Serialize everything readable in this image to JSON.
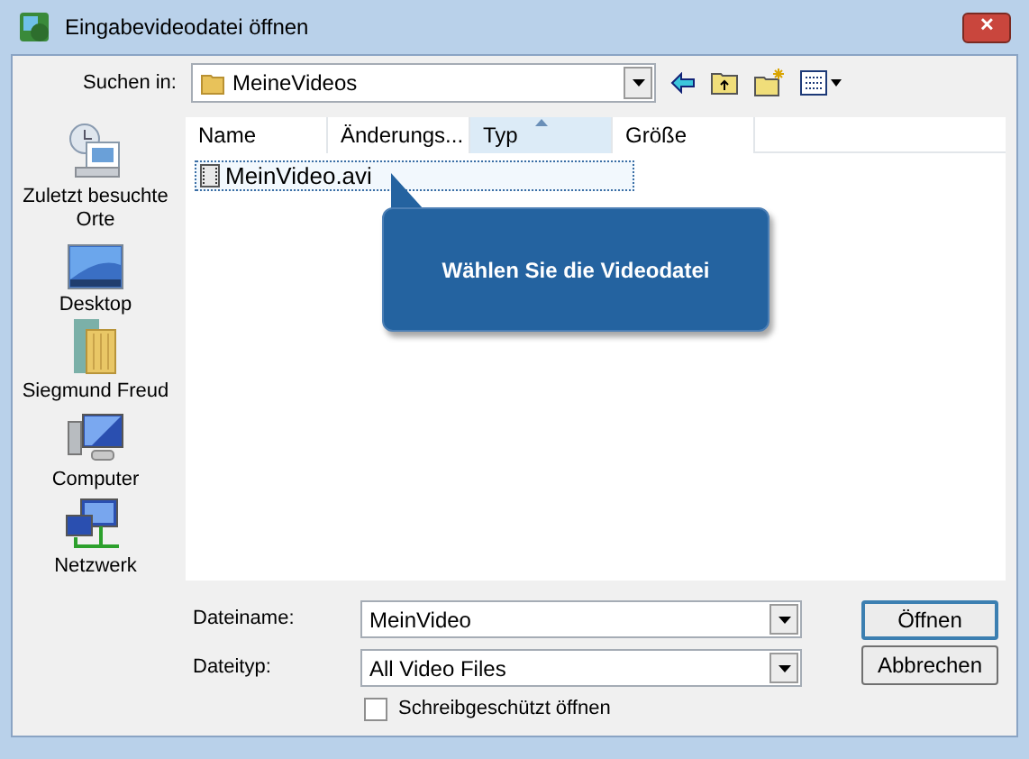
{
  "window": {
    "title": "Eingabevideodatei öffnen",
    "close": "✕"
  },
  "toolbar": {
    "label": "Suchen in:",
    "location": "MeineVideos"
  },
  "places": [
    {
      "label": "Zuletzt besuchte Orte",
      "kind": "recent"
    },
    {
      "label": "Desktop",
      "kind": "desktop"
    },
    {
      "label": "Siegmund Freud",
      "kind": "user"
    },
    {
      "label": "Computer",
      "kind": "computer"
    },
    {
      "label": "Netzwerk",
      "kind": "network"
    }
  ],
  "columns": [
    {
      "label": "Name",
      "sorted": false
    },
    {
      "label": "Änderungs...",
      "sorted": false
    },
    {
      "label": "Typ",
      "sorted": true
    },
    {
      "label": "Größe",
      "sorted": false
    }
  ],
  "files": [
    {
      "name": "MeinVideo.avi",
      "selected": true
    }
  ],
  "callout": {
    "text": "Wählen Sie die Videodatei"
  },
  "filename": {
    "label": "Dateiname:",
    "value": "MeinVideo"
  },
  "filetype": {
    "label": "Dateityp:",
    "value": "All Video Files"
  },
  "readonly": {
    "label": "Schreibgeschützt öffnen",
    "checked": false
  },
  "buttons": [
    "Öffnen",
    "Abbrechen"
  ]
}
